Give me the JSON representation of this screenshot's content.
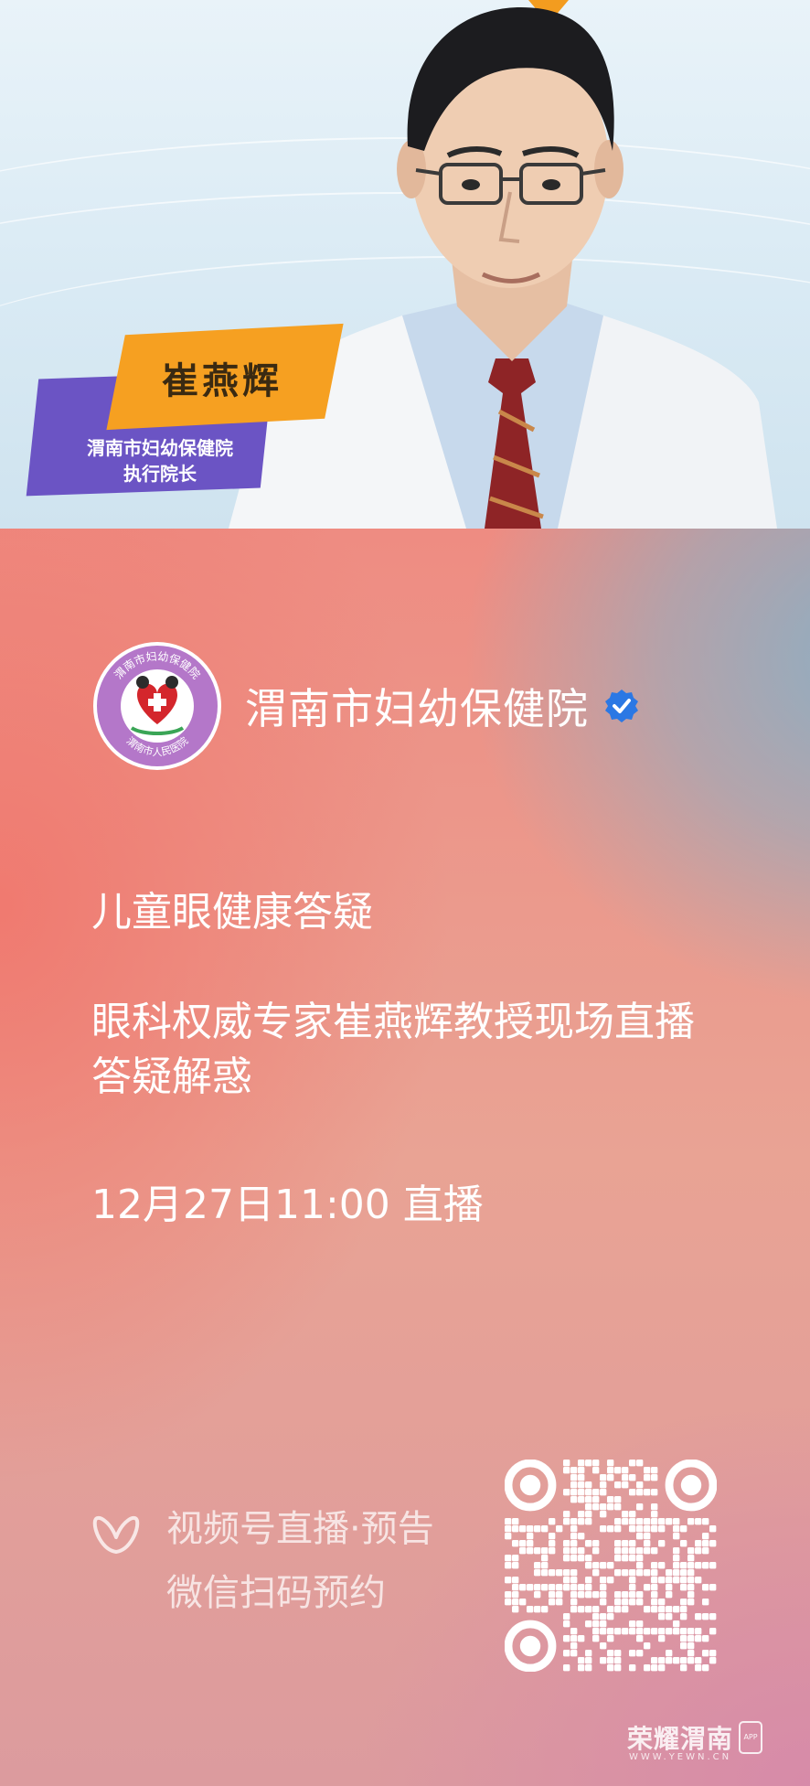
{
  "banner": {
    "doctor_name": "崔燕辉",
    "doctor_org": "渭南市妇幼保健院",
    "doctor_role": "执行院长",
    "colors": {
      "tag_orange": "#f6a021",
      "tag_purple": "#6b54c4"
    }
  },
  "account": {
    "name": "渭南市妇幼保健院",
    "avatar_icon": "hospital-logo-icon",
    "verified_icon": "verified-badge-icon",
    "logo_text_top": "渭南市妇幼保健院",
    "logo_text_bottom": "渭南市人民医院"
  },
  "live": {
    "title": "儿童眼健康答疑",
    "description": "眼科权威专家崔燕辉教授现场直播答疑解惑",
    "time": "12月27日11:00 直播"
  },
  "footer": {
    "channel_icon": "channels-butterfly-icon",
    "channel_label": "视频号直播·预告",
    "channel_hint": "微信扫码预约",
    "qr_icon": "qr-code-icon"
  },
  "watermark": {
    "title": "荣耀渭南",
    "sub": "WWW.YEWN.CN",
    "badge": "APP"
  }
}
